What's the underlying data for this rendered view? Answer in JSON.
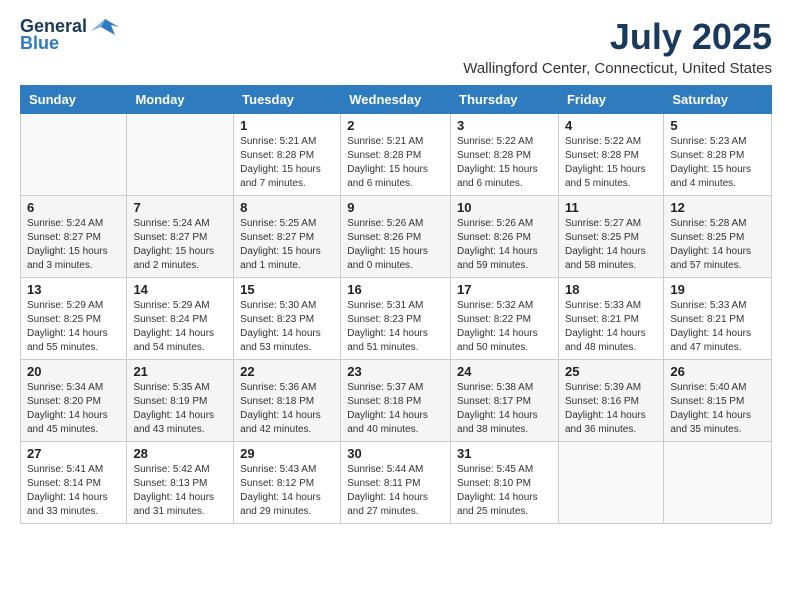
{
  "logo": {
    "line1": "General",
    "line2": "Blue"
  },
  "title": "July 2025",
  "subtitle": "Wallingford Center, Connecticut, United States",
  "header": {
    "colors": {
      "blue": "#2e7bbf",
      "dark": "#1a3a5c"
    }
  },
  "days_of_week": [
    "Sunday",
    "Monday",
    "Tuesday",
    "Wednesday",
    "Thursday",
    "Friday",
    "Saturday"
  ],
  "weeks": [
    [
      {
        "day": "",
        "info": ""
      },
      {
        "day": "",
        "info": ""
      },
      {
        "day": "1",
        "info": "Sunrise: 5:21 AM\nSunset: 8:28 PM\nDaylight: 15 hours and 7 minutes."
      },
      {
        "day": "2",
        "info": "Sunrise: 5:21 AM\nSunset: 8:28 PM\nDaylight: 15 hours and 6 minutes."
      },
      {
        "day": "3",
        "info": "Sunrise: 5:22 AM\nSunset: 8:28 PM\nDaylight: 15 hours and 6 minutes."
      },
      {
        "day": "4",
        "info": "Sunrise: 5:22 AM\nSunset: 8:28 PM\nDaylight: 15 hours and 5 minutes."
      },
      {
        "day": "5",
        "info": "Sunrise: 5:23 AM\nSunset: 8:28 PM\nDaylight: 15 hours and 4 minutes."
      }
    ],
    [
      {
        "day": "6",
        "info": "Sunrise: 5:24 AM\nSunset: 8:27 PM\nDaylight: 15 hours and 3 minutes."
      },
      {
        "day": "7",
        "info": "Sunrise: 5:24 AM\nSunset: 8:27 PM\nDaylight: 15 hours and 2 minutes."
      },
      {
        "day": "8",
        "info": "Sunrise: 5:25 AM\nSunset: 8:27 PM\nDaylight: 15 hours and 1 minute."
      },
      {
        "day": "9",
        "info": "Sunrise: 5:26 AM\nSunset: 8:26 PM\nDaylight: 15 hours and 0 minutes."
      },
      {
        "day": "10",
        "info": "Sunrise: 5:26 AM\nSunset: 8:26 PM\nDaylight: 14 hours and 59 minutes."
      },
      {
        "day": "11",
        "info": "Sunrise: 5:27 AM\nSunset: 8:25 PM\nDaylight: 14 hours and 58 minutes."
      },
      {
        "day": "12",
        "info": "Sunrise: 5:28 AM\nSunset: 8:25 PM\nDaylight: 14 hours and 57 minutes."
      }
    ],
    [
      {
        "day": "13",
        "info": "Sunrise: 5:29 AM\nSunset: 8:25 PM\nDaylight: 14 hours and 55 minutes."
      },
      {
        "day": "14",
        "info": "Sunrise: 5:29 AM\nSunset: 8:24 PM\nDaylight: 14 hours and 54 minutes."
      },
      {
        "day": "15",
        "info": "Sunrise: 5:30 AM\nSunset: 8:23 PM\nDaylight: 14 hours and 53 minutes."
      },
      {
        "day": "16",
        "info": "Sunrise: 5:31 AM\nSunset: 8:23 PM\nDaylight: 14 hours and 51 minutes."
      },
      {
        "day": "17",
        "info": "Sunrise: 5:32 AM\nSunset: 8:22 PM\nDaylight: 14 hours and 50 minutes."
      },
      {
        "day": "18",
        "info": "Sunrise: 5:33 AM\nSunset: 8:21 PM\nDaylight: 14 hours and 48 minutes."
      },
      {
        "day": "19",
        "info": "Sunrise: 5:33 AM\nSunset: 8:21 PM\nDaylight: 14 hours and 47 minutes."
      }
    ],
    [
      {
        "day": "20",
        "info": "Sunrise: 5:34 AM\nSunset: 8:20 PM\nDaylight: 14 hours and 45 minutes."
      },
      {
        "day": "21",
        "info": "Sunrise: 5:35 AM\nSunset: 8:19 PM\nDaylight: 14 hours and 43 minutes."
      },
      {
        "day": "22",
        "info": "Sunrise: 5:36 AM\nSunset: 8:18 PM\nDaylight: 14 hours and 42 minutes."
      },
      {
        "day": "23",
        "info": "Sunrise: 5:37 AM\nSunset: 8:18 PM\nDaylight: 14 hours and 40 minutes."
      },
      {
        "day": "24",
        "info": "Sunrise: 5:38 AM\nSunset: 8:17 PM\nDaylight: 14 hours and 38 minutes."
      },
      {
        "day": "25",
        "info": "Sunrise: 5:39 AM\nSunset: 8:16 PM\nDaylight: 14 hours and 36 minutes."
      },
      {
        "day": "26",
        "info": "Sunrise: 5:40 AM\nSunset: 8:15 PM\nDaylight: 14 hours and 35 minutes."
      }
    ],
    [
      {
        "day": "27",
        "info": "Sunrise: 5:41 AM\nSunset: 8:14 PM\nDaylight: 14 hours and 33 minutes."
      },
      {
        "day": "28",
        "info": "Sunrise: 5:42 AM\nSunset: 8:13 PM\nDaylight: 14 hours and 31 minutes."
      },
      {
        "day": "29",
        "info": "Sunrise: 5:43 AM\nSunset: 8:12 PM\nDaylight: 14 hours and 29 minutes."
      },
      {
        "day": "30",
        "info": "Sunrise: 5:44 AM\nSunset: 8:11 PM\nDaylight: 14 hours and 27 minutes."
      },
      {
        "day": "31",
        "info": "Sunrise: 5:45 AM\nSunset: 8:10 PM\nDaylight: 14 hours and 25 minutes."
      },
      {
        "day": "",
        "info": ""
      },
      {
        "day": "",
        "info": ""
      }
    ]
  ]
}
